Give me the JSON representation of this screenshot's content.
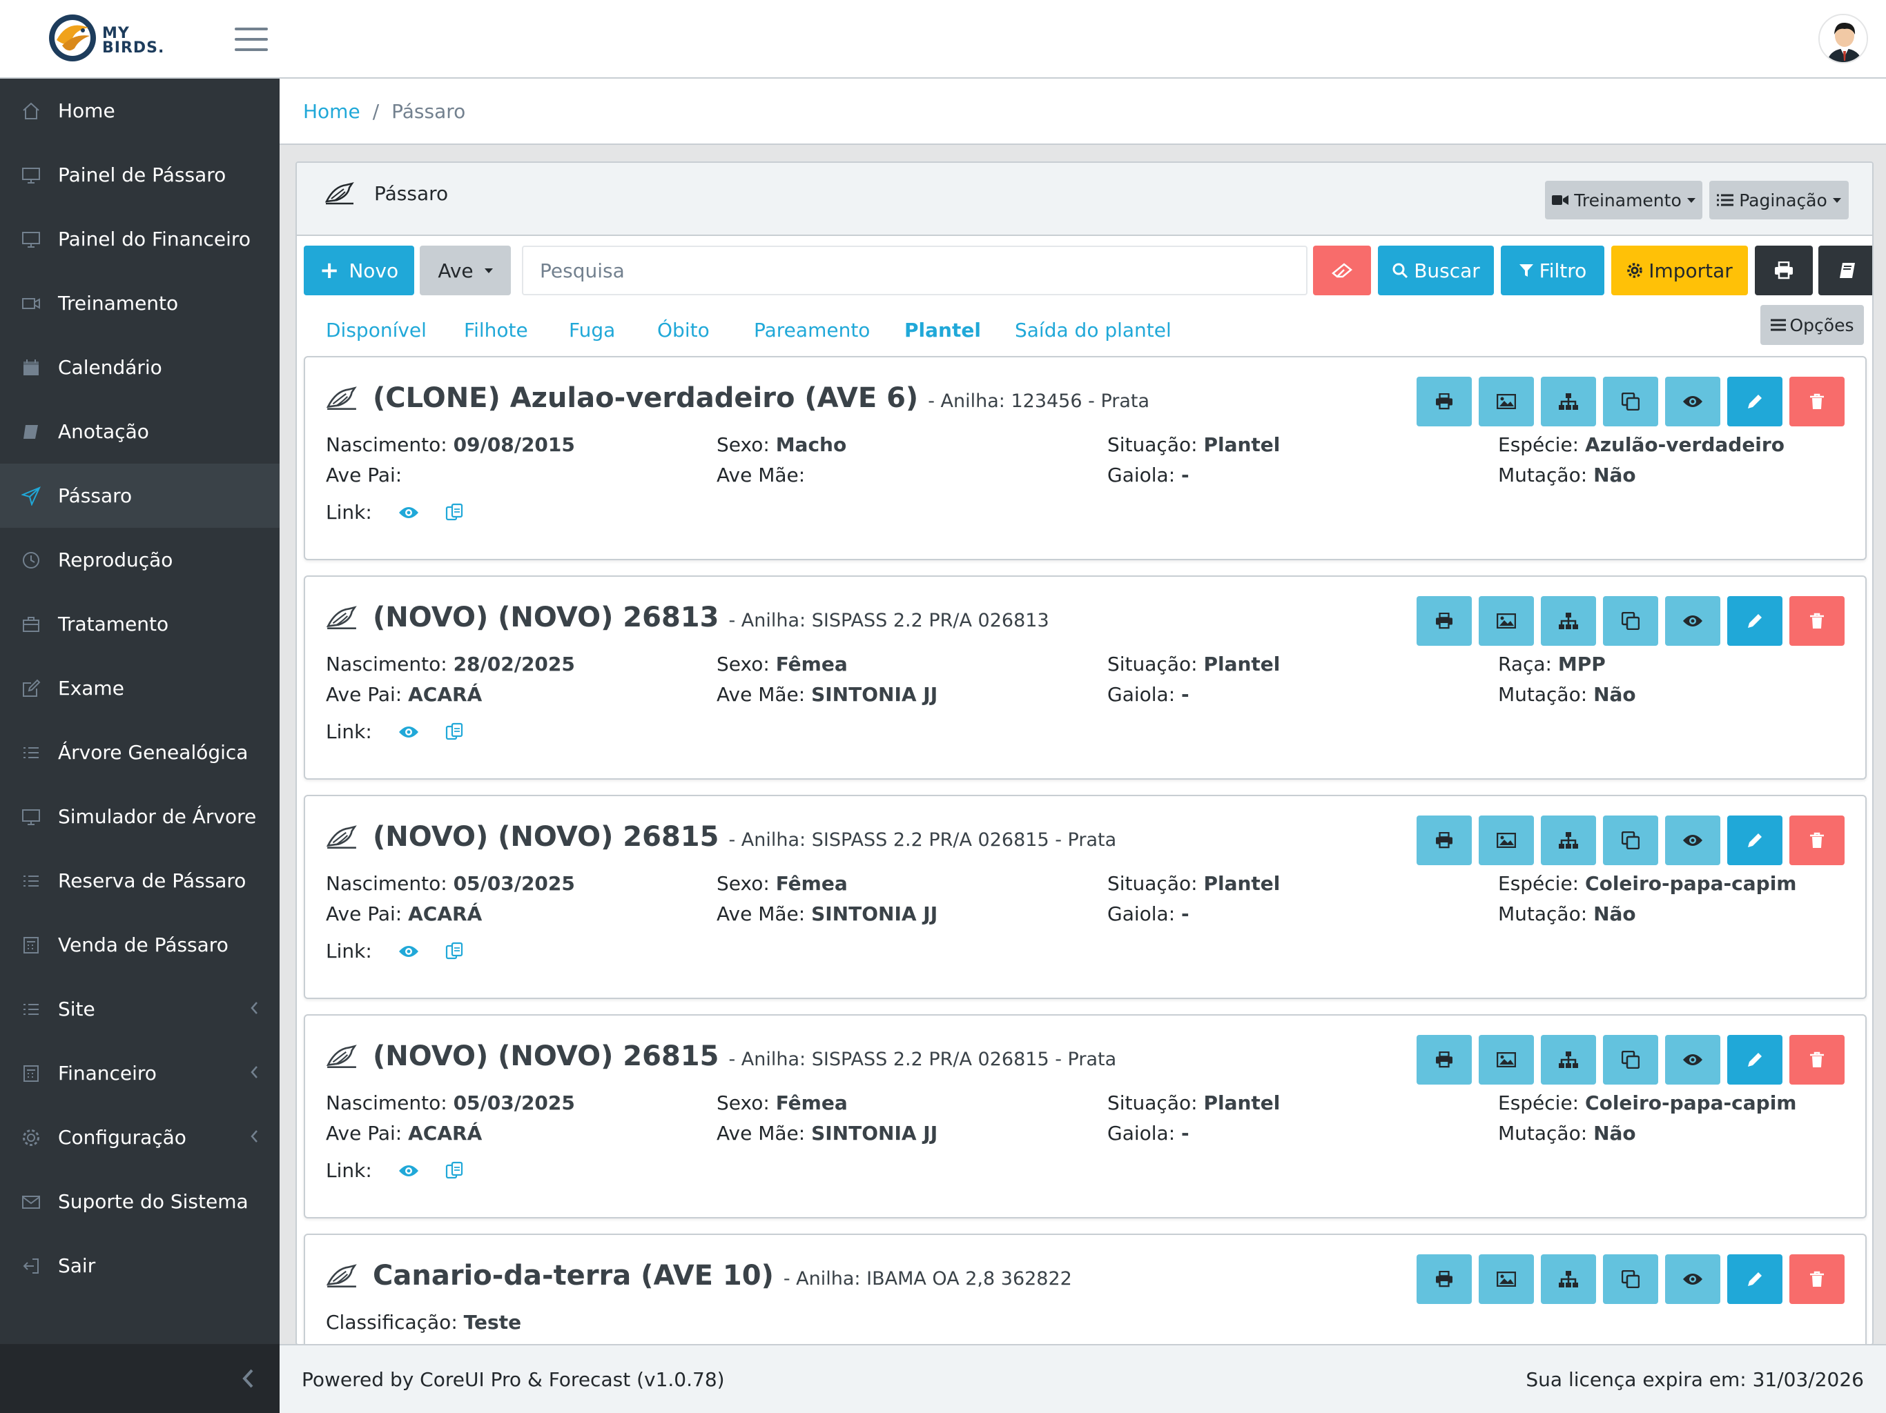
{
  "brand": {
    "line1": "MY",
    "line2": "BIRDS."
  },
  "sidebar": {
    "items": [
      {
        "label": "Home",
        "icon": "home-icon"
      },
      {
        "label": "Painel de Pássaro",
        "icon": "monitor-icon"
      },
      {
        "label": "Painel do Financeiro",
        "icon": "monitor-icon"
      },
      {
        "label": "Treinamento",
        "icon": "video-icon"
      },
      {
        "label": "Calendário",
        "icon": "calendar-icon"
      },
      {
        "label": "Anotação",
        "icon": "book-icon"
      },
      {
        "label": "Pássaro",
        "icon": "paper-plane-icon",
        "active": true
      },
      {
        "label": "Reprodução",
        "icon": "clock-icon"
      },
      {
        "label": "Tratamento",
        "icon": "briefcase-icon"
      },
      {
        "label": "Exame",
        "icon": "note-icon"
      },
      {
        "label": "Árvore Genealógica",
        "icon": "list-icon"
      },
      {
        "label": "Simulador de Árvore",
        "icon": "monitor-icon"
      },
      {
        "label": "Reserva de Pássaro",
        "icon": "list-icon"
      },
      {
        "label": "Venda de Pássaro",
        "icon": "calculator-icon"
      },
      {
        "label": "Site",
        "icon": "list-icon",
        "submenu": true
      },
      {
        "label": "Financeiro",
        "icon": "calculator-icon",
        "submenu": true
      },
      {
        "label": "Configuração",
        "icon": "settings-icon",
        "submenu": true
      },
      {
        "label": "Suporte do Sistema",
        "icon": "envelope-icon"
      },
      {
        "label": "Sair",
        "icon": "logout-icon"
      }
    ]
  },
  "breadcrumb": {
    "home": "Home",
    "separator": "/",
    "current": "Pássaro"
  },
  "card": {
    "title": "Pássaro",
    "treinamento_label": "Treinamento",
    "paginacao_label": "Paginação"
  },
  "toolbar": {
    "novo_label": "Novo",
    "ave_label": "Ave",
    "search_placeholder": "Pesquisa",
    "buscar_label": "Buscar",
    "filtro_label": "Filtro",
    "importar_label": "Importar"
  },
  "tabs": [
    "Disponível",
    "Filhote",
    "Fuga",
    "Óbito",
    "Pareamento",
    "Plantel",
    "Saída do plantel"
  ],
  "active_tab": "Plantel",
  "opcoes_label": "Opções",
  "birds": [
    {
      "name": "(CLONE) Azulao-verdadeiro (AVE 6)",
      "ring": "- Anilha: 123456 - Prata",
      "nascimento_label": "Nascimento:",
      "nascimento": "09/08/2015",
      "sexo_label": "Sexo:",
      "sexo": "Macho",
      "situacao_label": "Situação:",
      "situacao": "Plantel",
      "extra_label": "Espécie:",
      "extra": "Azulão-verdadeiro",
      "pai_label": "Ave Pai:",
      "pai": "",
      "mae_label": "Ave Mãe:",
      "mae": "",
      "gaiola_label": "Gaiola:",
      "gaiola": "-",
      "mutacao_label": "Mutação:",
      "mutacao": "Não",
      "link_label": "Link:"
    },
    {
      "name": "(NOVO) (NOVO) 26813",
      "ring": "- Anilha: SISPASS 2.2 PR/A 026813",
      "nascimento_label": "Nascimento:",
      "nascimento": "28/02/2025",
      "sexo_label": "Sexo:",
      "sexo": "Fêmea",
      "situacao_label": "Situação:",
      "situacao": "Plantel",
      "extra_label": "Raça:",
      "extra": "MPP",
      "pai_label": "Ave Pai:",
      "pai": "ACARÁ",
      "mae_label": "Ave Mãe:",
      "mae": "SINTONIA JJ",
      "gaiola_label": "Gaiola:",
      "gaiola": "-",
      "mutacao_label": "Mutação:",
      "mutacao": "Não",
      "link_label": "Link:"
    },
    {
      "name": "(NOVO) (NOVO) 26815",
      "ring": "- Anilha: SISPASS 2.2 PR/A 026815 - Prata",
      "nascimento_label": "Nascimento:",
      "nascimento": "05/03/2025",
      "sexo_label": "Sexo:",
      "sexo": "Fêmea",
      "situacao_label": "Situação:",
      "situacao": "Plantel",
      "extra_label": "Espécie:",
      "extra": "Coleiro-papa-capim",
      "pai_label": "Ave Pai:",
      "pai": "ACARÁ",
      "mae_label": "Ave Mãe:",
      "mae": "SINTONIA JJ",
      "gaiola_label": "Gaiola:",
      "gaiola": "-",
      "mutacao_label": "Mutação:",
      "mutacao": "Não",
      "link_label": "Link:"
    },
    {
      "name": "(NOVO) (NOVO) 26815",
      "ring": "- Anilha: SISPASS 2.2 PR/A 026815 - Prata",
      "nascimento_label": "Nascimento:",
      "nascimento": "05/03/2025",
      "sexo_label": "Sexo:",
      "sexo": "Fêmea",
      "situacao_label": "Situação:",
      "situacao": "Plantel",
      "extra_label": "Espécie:",
      "extra": "Coleiro-papa-capim",
      "pai_label": "Ave Pai:",
      "pai": "ACARÁ",
      "mae_label": "Ave Mãe:",
      "mae": "SINTONIA JJ",
      "gaiola_label": "Gaiola:",
      "gaiola": "-",
      "mutacao_label": "Mutação:",
      "mutacao": "Não",
      "link_label": "Link:"
    },
    {
      "name": "Canario-da-terra (AVE 10)",
      "ring": "- Anilha: IBAMA OA 2,8 362822",
      "classificacao_label": "Classificação:",
      "classificacao": "Teste"
    }
  ],
  "footer": {
    "left": "Powered by CoreUI Pro & Forecast (v1.0.78)",
    "right": "Sua licença expira em: 31/03/2026"
  },
  "colors": {
    "primary": "#20a8d8",
    "sidebar": "#2f353a",
    "danger": "#f86c6b",
    "warning": "#ffc107",
    "light_blue": "#63c2de"
  }
}
